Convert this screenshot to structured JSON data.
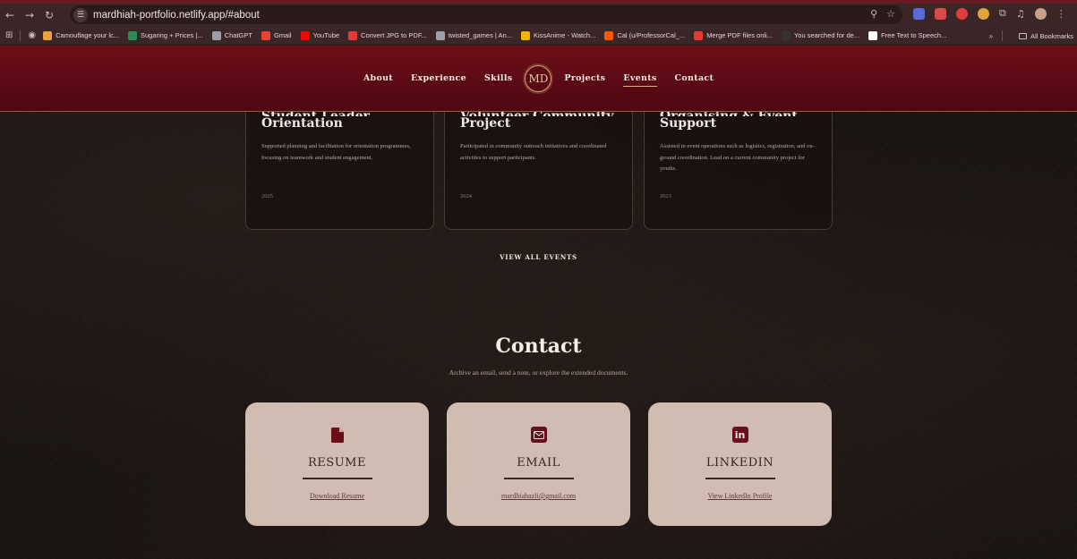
{
  "browser": {
    "url": "mardhiah-portfolio.netlify.app/#about",
    "bookmarks": [
      {
        "label": "Camouflage your lc...",
        "color": "#e8a33a"
      },
      {
        "label": "Sugaring + Prices |...",
        "color": "#2e8b57"
      },
      {
        "label": "ChatGPT",
        "color": "#9aa0a6"
      },
      {
        "label": "Gmail",
        "color": "#ea4335"
      },
      {
        "label": "YouTube",
        "color": "#ff0000"
      },
      {
        "label": "Convert JPG to PDF...",
        "color": "#e53935"
      },
      {
        "label": "twisted_games | An...",
        "color": "#9aa0a6"
      },
      {
        "label": "KissAnime - Watch...",
        "color": "#f5b400"
      },
      {
        "label": "Cal (u/ProfessorCal_...",
        "color": "#ff5700"
      },
      {
        "label": "Merge PDF files onli...",
        "color": "#e53935"
      },
      {
        "label": "You searched for de...",
        "color": "#333333"
      },
      {
        "label": "Free Text to Speech...",
        "color": "#ffffff"
      }
    ],
    "bookmarks_more": "»",
    "all_bookmarks": "All Bookmarks"
  },
  "nav": {
    "links_left": [
      "About",
      "Experience",
      "Skills"
    ],
    "logo": "MD",
    "links_right": [
      "Projects",
      "Events",
      "Contact"
    ],
    "active": "Events"
  },
  "events": [
    {
      "title_cut": "Student Leader",
      "title": "Orientation",
      "desc": "Supported planning and facilitation for orientation programmes, focusing on teamwork and student engagement.",
      "year": "2025"
    },
    {
      "title_cut": "Volunteer Community",
      "title": "Project",
      "desc": "Participated in community outreach initiatives and coordinated activities to support participants.",
      "year": "2024"
    },
    {
      "title_cut": "Organising & Event",
      "title": "Support",
      "desc": "Assisted in event operations such as logistics, registration, and on-ground coordination. Lead on a current community project for youths.",
      "year": "2023"
    }
  ],
  "view_all": "VIEW ALL EVENTS",
  "contact": {
    "title": "Contact",
    "subtitle": "Archive an email, send a note, or explore the extended documents.",
    "cards": [
      {
        "label": "RESUME",
        "link": "Download Resume",
        "icon": "document-icon"
      },
      {
        "label": "EMAIL",
        "link": "mardhiahazli@gmail.com",
        "icon": "envelope-icon"
      },
      {
        "label": "LINKEDIN",
        "link": "View LinkedIn Profile",
        "icon": "linkedin-icon"
      }
    ]
  },
  "colors": {
    "nav_bg": "#5a0a14",
    "card_bg": "#d1bcb1",
    "icon_bg": "#6a0f1a"
  }
}
